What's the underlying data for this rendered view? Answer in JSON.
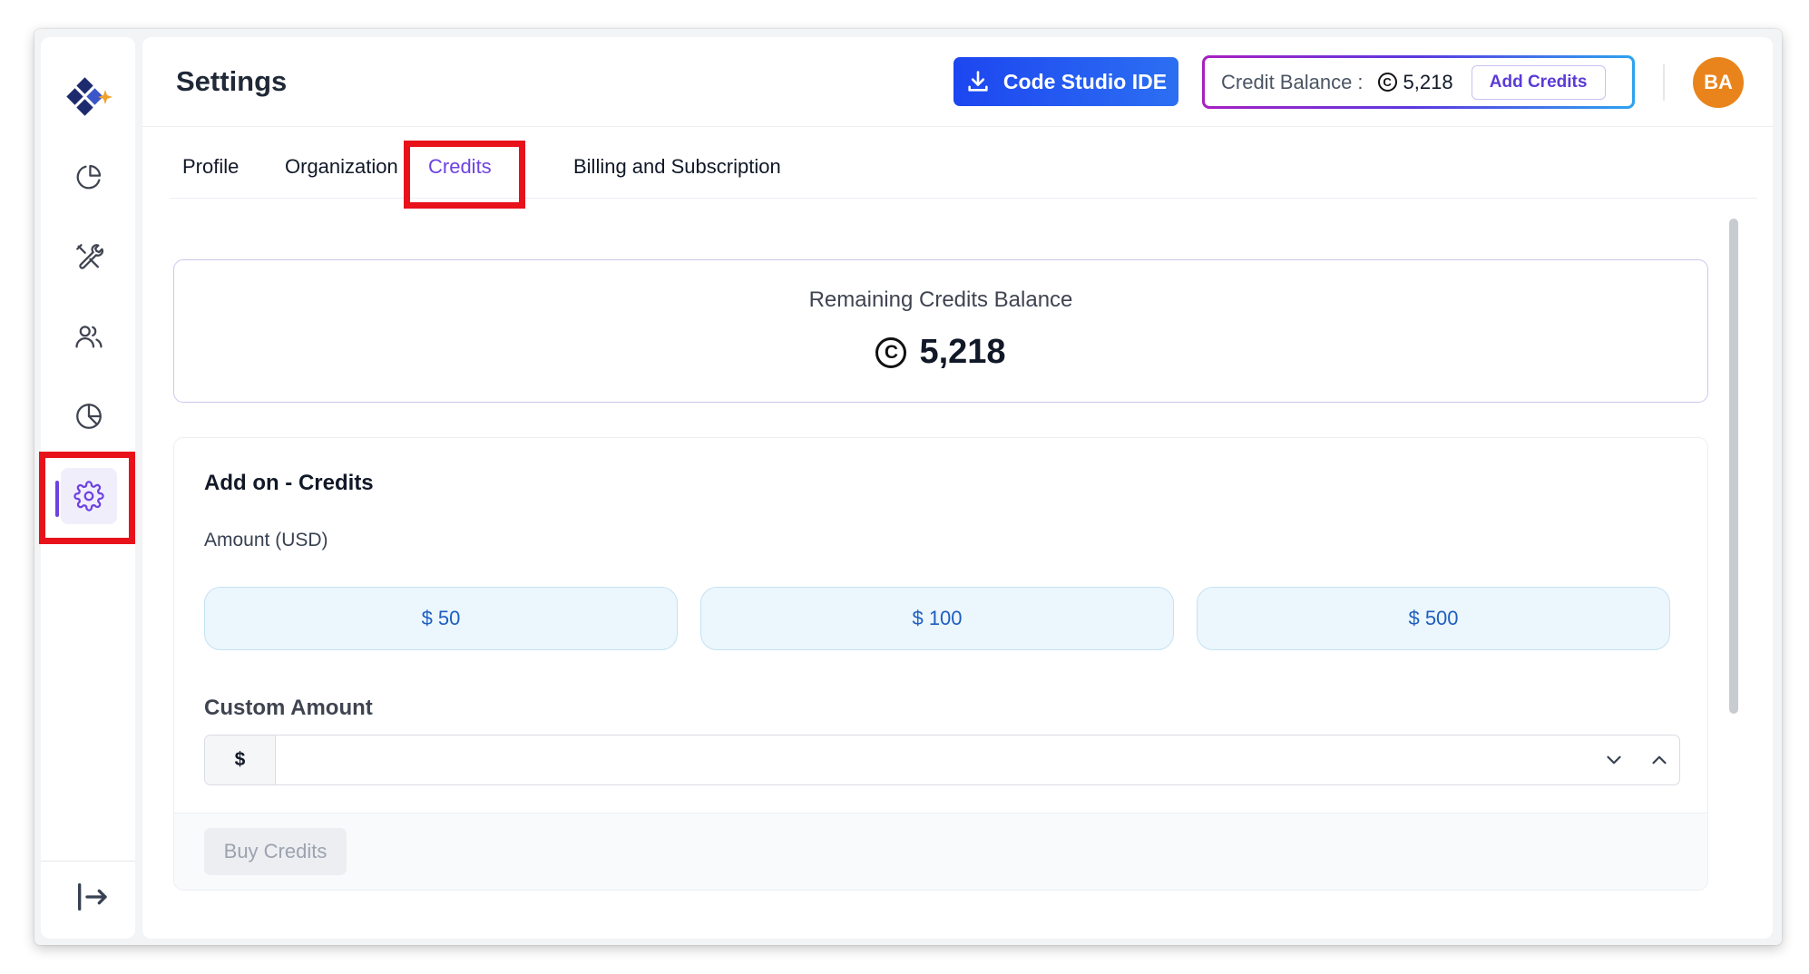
{
  "header": {
    "title": "Settings",
    "ide_button_label": "Code Studio IDE",
    "credit_balance_label": "Credit Balance :",
    "credit_balance_value": "5,218",
    "add_credits_label": "Add Credits",
    "avatar_initials": "BA"
  },
  "tabs": [
    {
      "label": "Profile",
      "active": false
    },
    {
      "label": "Organization",
      "active": false
    },
    {
      "label": "Credits",
      "active": true
    },
    {
      "label": "Billing and Subscription",
      "active": false
    }
  ],
  "sidebar": {
    "items": [
      {
        "icon": "dashboard-pie-icon",
        "active": false
      },
      {
        "icon": "tools-icon",
        "active": false
      },
      {
        "icon": "users-icon",
        "active": false
      },
      {
        "icon": "analytics-pie-icon",
        "active": false
      },
      {
        "icon": "gear-icon",
        "active": true
      }
    ],
    "footer_icon": "logout-icon"
  },
  "balance_card": {
    "label": "Remaining Credits Balance",
    "value": "5,218",
    "coin_symbol": "C"
  },
  "addon": {
    "title": "Add on - Credits",
    "amount_label": "Amount (USD)",
    "amounts": [
      "$ 50",
      "$ 100",
      "$ 500"
    ],
    "custom_label": "Custom Amount",
    "currency_prefix": "$",
    "custom_value": "",
    "buy_button_label": "Buy Credits"
  },
  "colors": {
    "accent": "#6d42e3",
    "ide_button": "#1d46f0",
    "avatar": "#e9841c",
    "highlight": "#e8121b",
    "amount_button_bg": "#ecf6fd"
  }
}
